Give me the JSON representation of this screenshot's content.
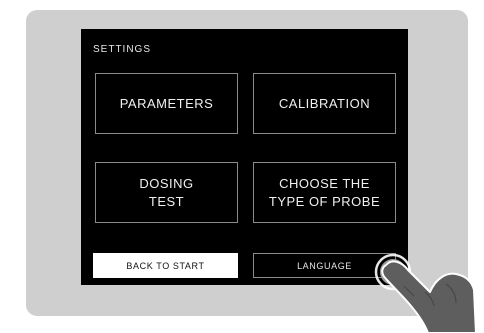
{
  "screen": {
    "title": "SETTINGS"
  },
  "menu": {
    "parameters": "PARAMETERS",
    "calibration": "CALIBRATION",
    "dosing_test": "DOSING\nTEST",
    "probe_type": "CHOOSE THE\nTYPE OF PROBE"
  },
  "footer": {
    "back_label": "BACK TO START",
    "language_label": "LANGUAGE"
  },
  "icons": {
    "hand": "pointing-hand-icon",
    "touch": "touch-indicator-icon"
  },
  "colors": {
    "device": "#cfcfcf",
    "screen": "#000000",
    "tile_border": "#8a8a8a",
    "hand": "#5e5e5e"
  }
}
